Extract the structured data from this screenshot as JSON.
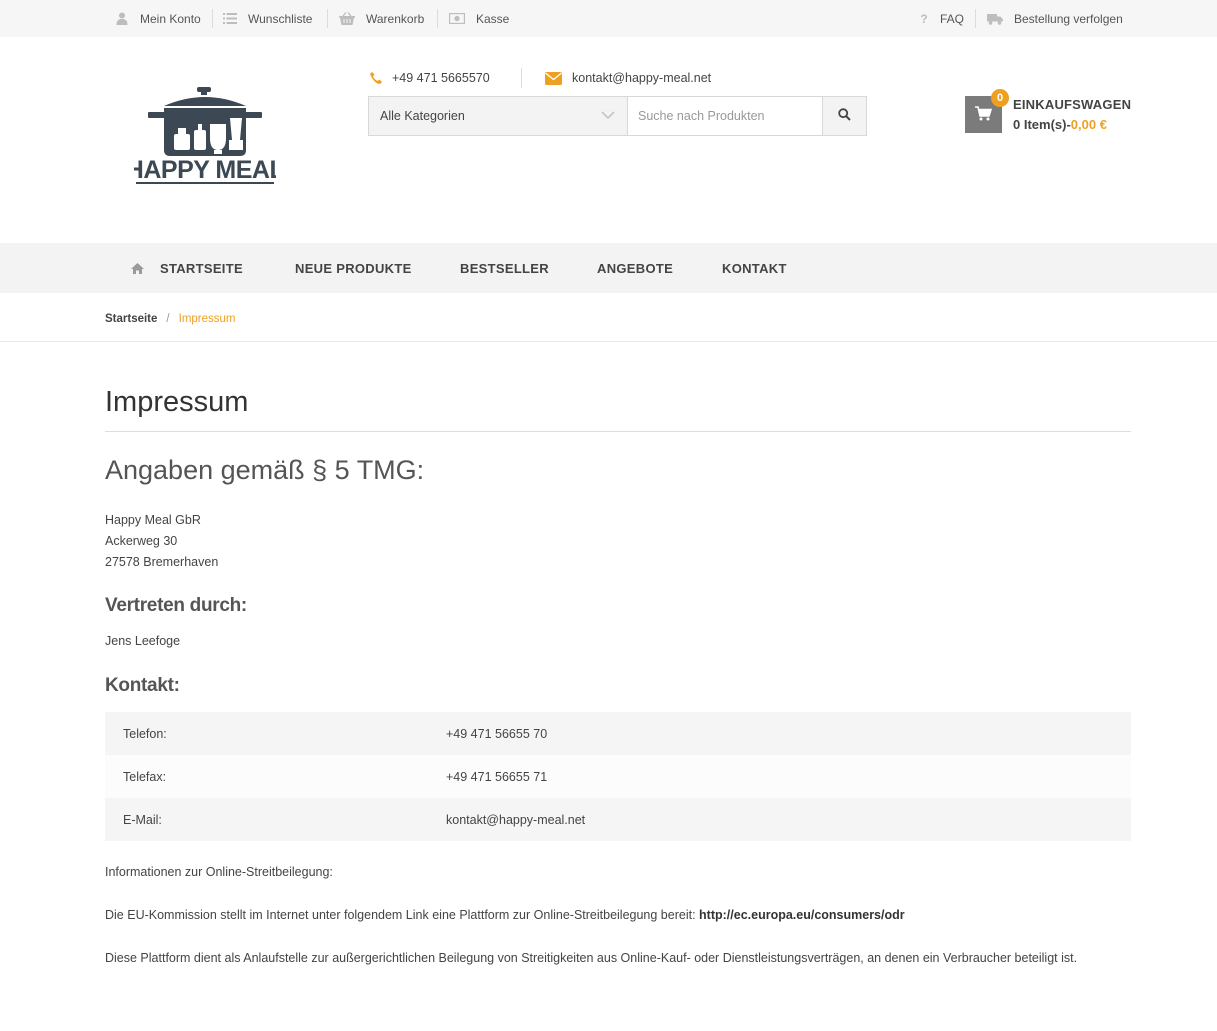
{
  "topbar": {
    "my_account": "Mein Konto",
    "wishlist": "Wunschliste",
    "basket": "Warenkorb",
    "checkout": "Kasse",
    "faq": "FAQ",
    "track_order": "Bestellung verfolgen"
  },
  "header": {
    "logo_text": "HAPPY MEAL",
    "phone": "+49 471 5665570",
    "email": "kontakt@happy-meal.net",
    "category_select": "Alle Kategorien",
    "search_placeholder": "Suche nach Produkten",
    "cart": {
      "count": "0",
      "title": "EINKAUFSWAGEN",
      "items": "0 Item(s)-",
      "total": "0,00 €"
    }
  },
  "nav": {
    "home": "STARTSEITE",
    "new_products": "NEUE PRODUKTE",
    "bestseller": "BESTSELLER",
    "offers": "ANGEBOTE",
    "contact": "KONTAKT"
  },
  "breadcrumb": {
    "home": "Startseite",
    "separator": "/",
    "current": "Impressum"
  },
  "content": {
    "title": "Impressum",
    "section_heading": "Angaben gemäß § 5 TMG:",
    "address": {
      "company": "Happy Meal GbR",
      "street": "Ackerweg 30",
      "city": "27578 Bremerhaven"
    },
    "represented_heading": "Vertreten durch:",
    "represented_name": "Jens Leefoge",
    "contact_heading": "Kontakt:",
    "contact_rows": [
      {
        "label": "Telefon:",
        "value": "+49 471 56655 70"
      },
      {
        "label": "Telefax:",
        "value": "+49 471 56655 71"
      },
      {
        "label": "E-Mail:",
        "value": "kontakt@happy-meal.net"
      }
    ],
    "odr_label": "Informationen zur Online-Streitbeilegung:",
    "odr_text": "Die EU-Kommission stellt im Internet unter folgendem Link eine Plattform zur Online-Streitbeilegung bereit: ",
    "odr_link": "http://ec.europa.eu/consumers/odr",
    "odr_text2": "Diese Plattform dient als Anlaufstelle zur außergerichtlichen Beilegung von Streitigkeiten aus Online-Kauf- oder Dienstleistungsverträgen, an denen ein Verbraucher beteiligt ist."
  },
  "colors": {
    "accent": "#f0a020",
    "text": "#444444",
    "nav_bg": "#f3f3f3"
  }
}
